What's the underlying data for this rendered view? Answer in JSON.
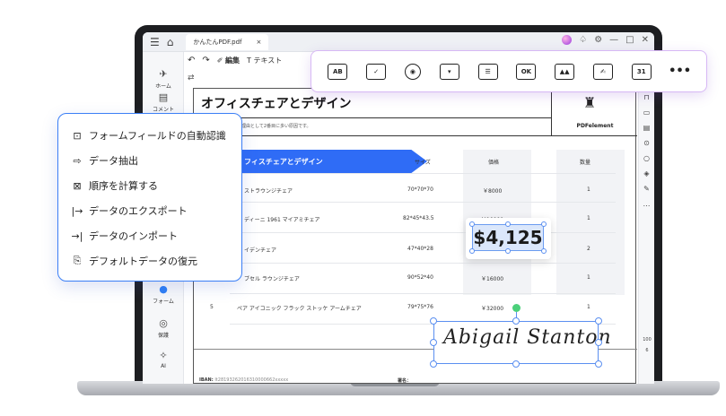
{
  "window": {
    "tab_title": "かんたんPDF.pdf",
    "tab_close": "×"
  },
  "titlebar": {
    "hamburger": "☰",
    "home": "⌂",
    "bell": "♤",
    "gear": "⚙",
    "minimize": "—",
    "maximize": "□",
    "close": "✕"
  },
  "toolbar": {
    "undo": "↶",
    "redo": "↷",
    "edit_label": "編集",
    "text_label": "テキスト",
    "edit_prefix": "✐",
    "text_prefix": "T"
  },
  "left_sidebar": [
    {
      "label": "ホーム",
      "icon": "rocket-icon",
      "glyph": "✈"
    },
    {
      "label": "コメント",
      "icon": "comment-icon",
      "glyph": "▤"
    },
    {
      "label": "フォーム",
      "icon": "form-icon",
      "glyph": "●"
    },
    {
      "label": "保護",
      "icon": "shield-icon",
      "glyph": "◎"
    },
    {
      "label": "AI",
      "icon": "ai-wand-icon",
      "glyph": "✧"
    }
  ],
  "right_sidebar": {
    "icons": [
      "⊓",
      "▭",
      "▤",
      "⊙",
      "○",
      "◈",
      "✎",
      "…"
    ],
    "page_num": "100",
    "page_sub": "6"
  },
  "document": {
    "title": "オフィスチェアとデザイン",
    "subtitle": "価格は従業員の欠勤理由として2番目に多い原因です。",
    "brand": "PDFelement",
    "brand_icon": "♜",
    "table_header": "フィスチェアとデザイン",
    "columns": [
      "サイズ",
      "価格",
      "数量"
    ],
    "rows": [
      {
        "num": "",
        "name": "ストラウンジチェア",
        "size": "70*70*70",
        "price": "￥8000",
        "qty": "1"
      },
      {
        "num": "",
        "name": "ディーニ 1961 マイアミチェア",
        "size": "82*45*43.5",
        "price": "￥10000",
        "qty": "1"
      },
      {
        "num": "",
        "name": "イデンチェア",
        "size": "47*40*28",
        "price": "",
        "qty": "2"
      },
      {
        "num": "",
        "name": "ブセル ラウンジチェア",
        "size": "90*52*40",
        "price": "￥16000",
        "qty": "1"
      },
      {
        "num": "5",
        "name": "ペア アイコニック フラック ストッケ アームチェア",
        "size": "79*75*76",
        "price": "￥32000",
        "qty": "1"
      }
    ],
    "iban_label": "IBAN:",
    "iban_value": "It28193262016310000662xxxxx",
    "sign_label": "署名："
  },
  "form_toolbar": [
    {
      "label": "AB",
      "icon": "text-field-icon",
      "style": "box"
    },
    {
      "label": "✓",
      "icon": "checkbox-icon",
      "style": "box"
    },
    {
      "label": "◉",
      "icon": "radio-button-icon",
      "style": "round"
    },
    {
      "label": "▾",
      "icon": "dropdown-icon",
      "style": "box"
    },
    {
      "label": "☰",
      "icon": "list-box-icon",
      "style": "box"
    },
    {
      "label": "OK",
      "icon": "button-field-icon",
      "style": "box"
    },
    {
      "label": "▲▲",
      "icon": "image-field-icon",
      "style": "box"
    },
    {
      "label": "✍",
      "icon": "signature-field-icon",
      "style": "box"
    },
    {
      "label": "31",
      "icon": "date-field-icon",
      "style": "box"
    },
    {
      "label": "•••",
      "icon": "more-icon",
      "style": "none"
    }
  ],
  "feature_menu": [
    {
      "label": "フォームフィールドの自動認識",
      "icon": "auto-recognize-icon",
      "glyph": "⊡"
    },
    {
      "label": "データ抽出",
      "icon": "data-extract-icon",
      "glyph": "⇨"
    },
    {
      "label": "順序を計算する",
      "icon": "calculate-icon",
      "glyph": "⊠"
    },
    {
      "label": "データのエクスポート",
      "icon": "export-icon",
      "glyph": "|→"
    },
    {
      "label": "データのインポート",
      "icon": "import-icon",
      "glyph": "→|"
    },
    {
      "label": "デフォルトデータの復元",
      "icon": "restore-icon",
      "glyph": "⎘"
    }
  ],
  "price_overlay": "$4,125",
  "signature_text": "Abigail Stanton",
  "colors": {
    "accent_blue": "#2f6cf6",
    "menu_border": "#3b7ff6",
    "toolbar_border": "#d7b8f5",
    "handle_green": "#4bd07a"
  }
}
